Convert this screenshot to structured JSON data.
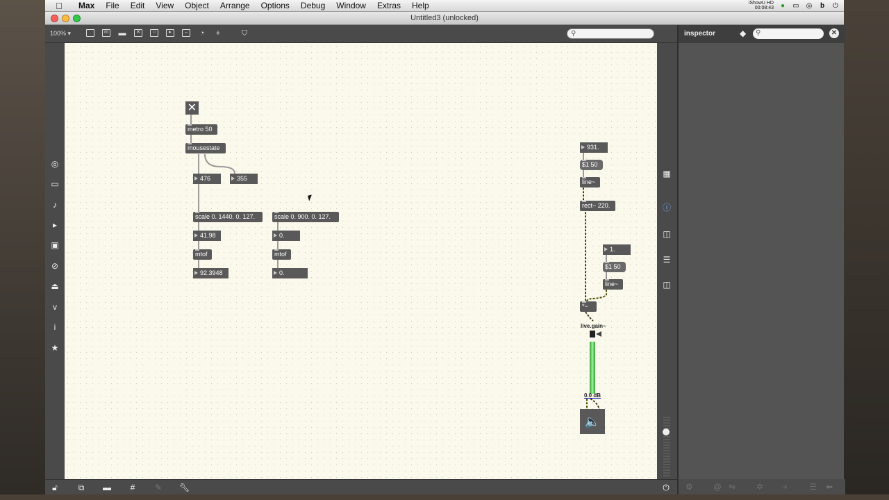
{
  "menubar": {
    "app_name": "Max",
    "items": [
      "File",
      "Edit",
      "View",
      "Object",
      "Arrange",
      "Options",
      "Debug",
      "Window",
      "Extras",
      "Help"
    ],
    "status_line1": "iShowU HD",
    "status_line2": "00:08:43"
  },
  "window": {
    "title": "Untitled3 (unlocked)"
  },
  "toolbar": {
    "zoom": "100%",
    "icons": [
      "new-object-icon",
      "new-message-icon",
      "comment-icon",
      "toggle-object-icon",
      "button-object-icon",
      "number-box-icon",
      "slider-icon",
      "dial-icon",
      "add-object-icon",
      "paint-bucket-icon"
    ],
    "search_placeholder": ""
  },
  "inspector": {
    "title": "inspector",
    "search_placeholder": ""
  },
  "patch": {
    "toggle_glyph": "✕",
    "metro": "metro 50",
    "mousestate": "mousestate",
    "num_x": "476",
    "num_y": "355",
    "scale1": "scale 0. 1440. 0. 127.",
    "scale2": "scale 0. 900. 0. 127.",
    "num_scaled1": "41.98",
    "num_scaled2": "0.",
    "mtof1": "mtof",
    "mtof2": "mtof",
    "freq1": "92.3948",
    "freq2": "0.",
    "num_freq": "931.",
    "msg_line1": "$1 50",
    "line1": "line~",
    "rect": "rect~ 220.",
    "num_amp": "1.",
    "msg_line2": "$1 50",
    "line2": "line~",
    "mult": "*~",
    "gain_label": "live.gain~",
    "gain_value": "0.0 dB",
    "gain_level": 0.75
  }
}
